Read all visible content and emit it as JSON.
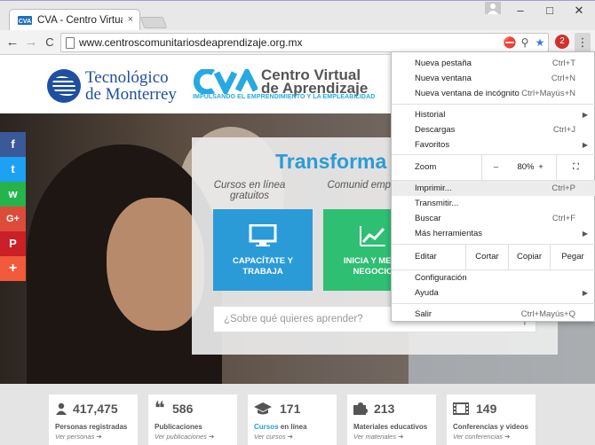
{
  "browser": {
    "tab_title": "CVA - Centro Virtual de A",
    "tab_close": "×",
    "url": "www.centroscomunitariosdeaprendizaje.org.mx",
    "back": "←",
    "forward": "→",
    "reload": "C",
    "minimize": "–",
    "maximize": "□",
    "close": "✕",
    "menu_dots": "⋮",
    "ext_badge": "2"
  },
  "header": {
    "tec_line1": "Tecnológico",
    "tec_line2": "de Monterrey",
    "cva_line1": "Centro Virtual",
    "cva_line2": "de Aprendizaje",
    "cva_tagline": "IMPULSANDO EL EMPRENDIMIENTO Y LA EMPLEABILIDAD"
  },
  "hero": {
    "title": "Transforma",
    "sub1": "Cursos en línea gratuitos",
    "sub2": "Comunid emprende",
    "card1": "CAPACÍTATE Y TRABAJA",
    "card2": "INICIA Y MEJO NEGOCIO",
    "search_placeholder": "¿Sobre qué quieres aprender?"
  },
  "social": [
    "f",
    "t",
    "w",
    "G+",
    "P",
    "+"
  ],
  "stats": [
    {
      "icon": "person-icon",
      "num": "417,475",
      "label": "Personas registradas",
      "link": "Ver personas ➜"
    },
    {
      "icon": "quote-icon",
      "num": "586",
      "label": "Publicaciones",
      "link": "Ver publicaciones ➜"
    },
    {
      "icon": "graduation-cap-icon",
      "num": "171",
      "label_a": "Cursos",
      "label_b": " en línea",
      "link": "Ver cursos ➜"
    },
    {
      "icon": "puzzle-icon",
      "num": "213",
      "label": "Materiales educativos",
      "link": "Ver materiales ➜"
    },
    {
      "icon": "film-icon",
      "num": "149",
      "label": "Conferencias y videos",
      "link": "Ver conferencias ➜"
    }
  ],
  "menu": {
    "new_tab": "Nueva pestaña",
    "new_tab_sc": "Ctrl+T",
    "new_window": "Nueva ventana",
    "new_window_sc": "Ctrl+N",
    "incognito": "Nueva ventana de incógnito",
    "incognito_sc": "Ctrl+Mayús+N",
    "history": "Historial",
    "downloads": "Descargas",
    "downloads_sc": "Ctrl+J",
    "bookmarks": "Favoritos",
    "zoom": "Zoom",
    "zoom_minus": "–",
    "zoom_value": "80%",
    "zoom_plus": "+",
    "print": "Imprimir...",
    "print_sc": "Ctrl+P",
    "cast": "Transmitir...",
    "find": "Buscar",
    "find_sc": "Ctrl+F",
    "more_tools": "Más herramientas",
    "edit": "Editar",
    "cut": "Cortar",
    "copy": "Copiar",
    "paste": "Pegar",
    "settings": "Configuración",
    "help": "Ayuda",
    "exit": "Salir",
    "exit_sc": "Ctrl+Mayús+Q"
  },
  "colors": {
    "accent_blue": "#2b9bd7",
    "accent_green": "#2ebf73",
    "tec_blue": "#1f4fa0"
  }
}
